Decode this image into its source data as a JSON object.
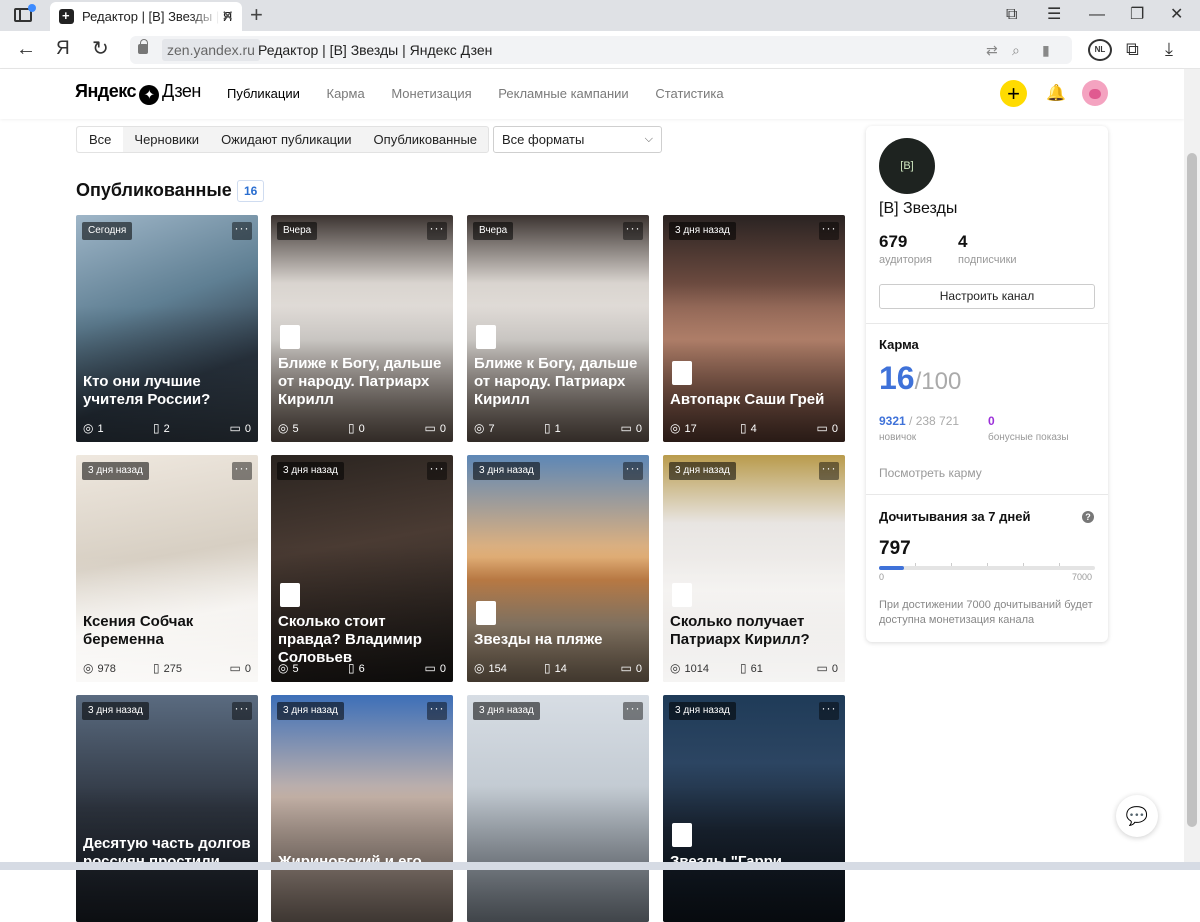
{
  "browser": {
    "tab_title": "Редактор | [В] Звезды | Я",
    "url_domain": "zen.yandex.ru",
    "page_title": "Редактор | [В] Звезды | Яндекс Дзен",
    "nav_back": "←",
    "nav_yandex": "Я",
    "nav_reload": "↻",
    "newtab": "+",
    "close": "✕",
    "nl_badge": "NL"
  },
  "header": {
    "logo_text": "Яндекс",
    "logo_text2": "Дзен",
    "nav": [
      "Публикации",
      "Карма",
      "Монетизация",
      "Рекламные кампании",
      "Статистика"
    ],
    "plus": "+"
  },
  "filters": {
    "tabs": [
      "Все",
      "Черновики",
      "Ожидают публикации",
      "Опубликованные"
    ],
    "format_select": "Все форматы"
  },
  "section": {
    "title": "Опубликованные",
    "count": "16"
  },
  "cards": [
    {
      "badge": "Сегодня",
      "title": "Кто они лучшие учителя России?",
      "views": "1",
      "reads": "2",
      "comments": "0"
    },
    {
      "badge": "Вчера",
      "title": "Ближе к Богу, дальше от народу. Патриарх Кирилл",
      "views": "5",
      "reads": "0",
      "comments": "0"
    },
    {
      "badge": "Вчера",
      "title": "Ближе к Богу, дальше от народу. Патриарх Кирилл",
      "views": "7",
      "reads": "1",
      "comments": "0"
    },
    {
      "badge": "3 дня назад",
      "title": "Автопарк Саши Грей",
      "views": "17",
      "reads": "4",
      "comments": "0"
    },
    {
      "badge": "3 дня назад",
      "title": "Ксения Собчак беременна",
      "views": "978",
      "reads": "275",
      "comments": "0"
    },
    {
      "badge": "3 дня назад",
      "title": "Сколько стоит правда? Владимир Соловьев",
      "views": "5",
      "reads": "6",
      "comments": "0"
    },
    {
      "badge": "3 дня назад",
      "title": "Звезды на пляже",
      "views": "154",
      "reads": "14",
      "comments": "0"
    },
    {
      "badge": "3 дня назад",
      "title": "Сколько получает Патриарх Кирилл?",
      "views": "1014",
      "reads": "61",
      "comments": "0"
    },
    {
      "badge": "3 дня назад",
      "title": "Десятую часть долгов россиян простили"
    },
    {
      "badge": "3 дня назад",
      "title": "Жириновский и его"
    },
    {
      "badge": "3 дня назад",
      "title": ""
    },
    {
      "badge": "3 дня назад",
      "title": "Звезды \"Гарри"
    }
  ],
  "sidebar": {
    "avatar_text": "[В]",
    "channel_name": "[В] Звезды",
    "audience_value": "679",
    "audience_label": "аудитория",
    "subs_value": "4",
    "subs_label": "подписчики",
    "setup_button": "Настроить канал",
    "karma_label": "Карма",
    "karma_value": "16",
    "karma_max": "/100",
    "karma_points": "9321",
    "karma_points_total": " / 238 721",
    "karma_level": "новичок",
    "bonus_value": "0",
    "bonus_label": "бонусные показы",
    "karma_link": "Посмотреть карму",
    "reads_label": "Дочитывания за 7 дней",
    "reads_value": "797",
    "reads_min": "0",
    "reads_max": "7000",
    "reads_progress": 0.114,
    "reads_note": "При достижении 7000 дочитываний будет доступна монетизация канала"
  },
  "colors": {
    "accent": "#3f72d9",
    "plus": "#ffdb00",
    "bonus": "#9b30d9"
  }
}
